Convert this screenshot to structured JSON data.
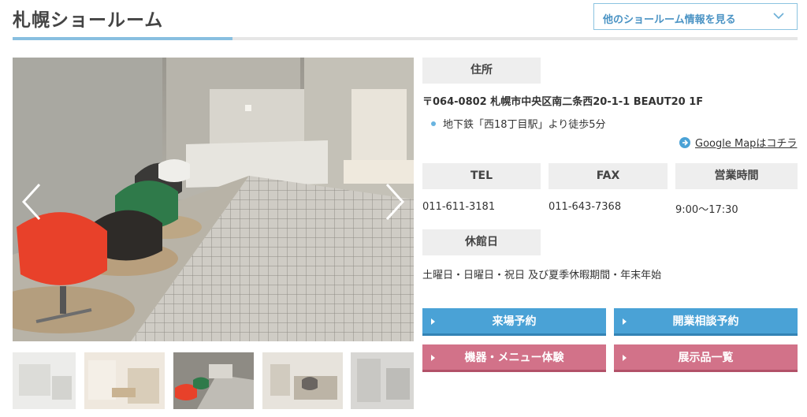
{
  "header": {
    "title": "札幌ショールーム",
    "other_showrooms": "他のショールーム情報を見る"
  },
  "gallery": {
    "thumbnail_count": 5,
    "active_index": 2
  },
  "info": {
    "address_label": "住所",
    "address": "〒064-0802 札幌市中央区南二条西20-1-1 BEAUT20 1F",
    "access": "地下鉄「西18丁目駅」より徒歩5分",
    "map_link": "Google Mapはコチラ",
    "tel_label": "TEL",
    "tel": "011-611-3181",
    "fax_label": "FAX",
    "fax": "011-643-7368",
    "hours_label": "営業時間",
    "hours": "9:00〜17:30",
    "closed_label": "休館日",
    "closed": "土曜日・日曜日・祝日 及び夏季休暇期間・年末年始"
  },
  "buttons": {
    "visit_reservation": "来場予約",
    "opening_consultation": "開業相談予約",
    "equipment_menu_trial": "機器・メニュー体験",
    "exhibit_list": "展示品一覧"
  },
  "colors": {
    "accent_blue": "#4aa2d6",
    "accent_pink": "#d27289",
    "chair_red": "#e8412a",
    "chair_green": "#2f7a4a"
  }
}
